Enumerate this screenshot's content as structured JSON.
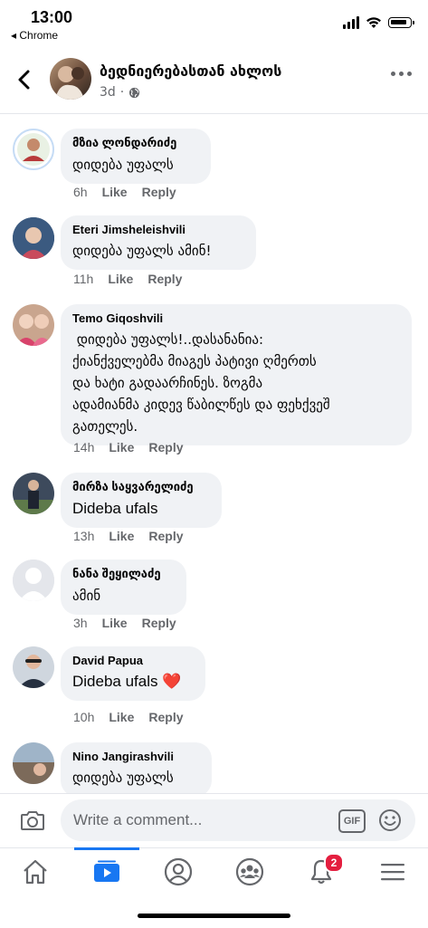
{
  "status_bar": {
    "time": "13:00",
    "back_app": "◂ Chrome"
  },
  "header": {
    "title": "ბედნიერებასთან ახლოს",
    "time_ago": "3d"
  },
  "comments": [
    {
      "name": "მზია ლონდარიძე",
      "text": "დიდება უფალს",
      "time": "6h",
      "like": "Like",
      "reply": "Reply"
    },
    {
      "name": "Eteri Jimsheleishvili",
      "text": "დიდება უფალს ამინ!",
      "time": "11h",
      "like": "Like",
      "reply": "Reply"
    },
    {
      "name": "Temo Giqoshvili",
      "text_lines": [
        " დიდება უფალს!..დასანანია:",
        "ქიანქველებმა მიაგეს პატივი ღმერთს",
        "და ხატი გადაარჩინეს. ზოგმა",
        "ადამიანმა კიდევ წაბილწეს და ფეხქვეშ",
        "გათელეს."
      ],
      "time": "14h",
      "like": "Like",
      "reply": "Reply"
    },
    {
      "name": "მირზა საყვარელიძე",
      "text": "Dideba ufals",
      "time": "13h",
      "like": "Like",
      "reply": "Reply"
    },
    {
      "name": "ნანა შეყილაძე",
      "text": "ამინ",
      "time": "3h",
      "like": "Like",
      "reply": "Reply"
    },
    {
      "name": "David Papua",
      "text": "Dideba ufals",
      "emoji": "❤️",
      "time": "10h",
      "like": "Like",
      "reply": "Reply"
    },
    {
      "name": "Nino  Jangirashvili",
      "text": "დიდება უფალს"
    }
  ],
  "composer": {
    "placeholder": "Write a comment...",
    "gif_label": "GIF"
  },
  "tabbar": {
    "notification_count": "2"
  },
  "colors": {
    "accent": "#1877f2",
    "bubble": "#f0f2f5",
    "secondary_text": "#65676b",
    "badge": "#e41e3f"
  }
}
